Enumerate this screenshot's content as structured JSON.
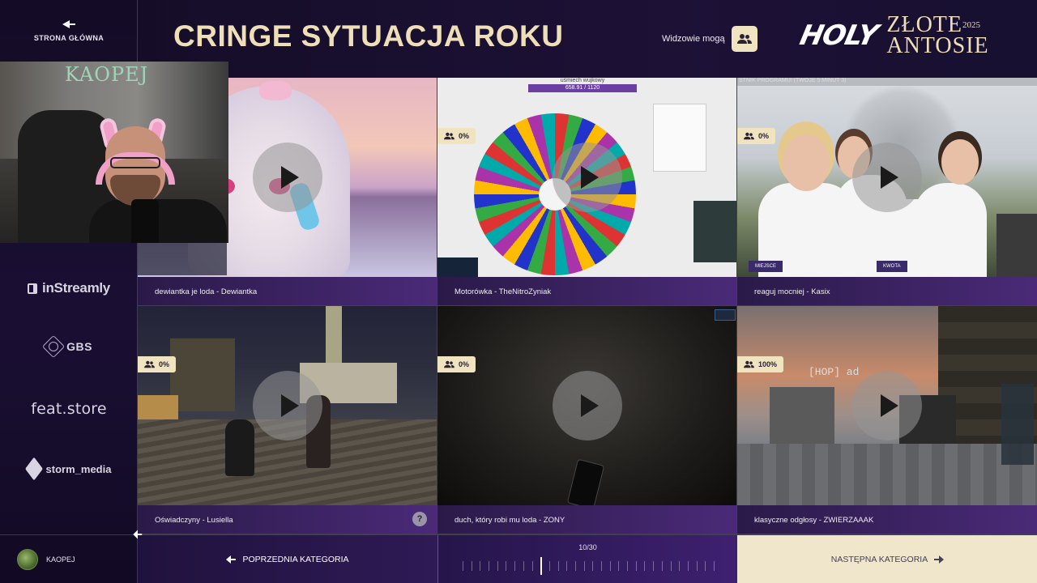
{
  "sidebar": {
    "home_label": "STRONA GŁÓWNA",
    "sponsors": [
      "inStreamly",
      "GBS",
      "feat.store",
      "storm_media"
    ],
    "user_name": "KAOPEJ"
  },
  "header": {
    "title": "CRINGE SYTUACJA ROKU",
    "viewers_label": "Widzowie mogą",
    "logo_holy": "HOLY",
    "logo_line1": "ZŁOTE",
    "logo_year": "2025",
    "logo_line2": "ANTOSIE"
  },
  "webcam": {
    "wall_text": "KAOPEJ"
  },
  "clips": [
    {
      "caption": "dewiantka je loda - Dewiantka",
      "percent": "",
      "has_help": false
    },
    {
      "caption": "Motorówka - TheNitroZyniak",
      "percent": "0%",
      "has_help": false,
      "overlay_title": "uśmiech wujkowy",
      "overlay_value": "658.91 / 1120"
    },
    {
      "caption": "reaguj mocniej - Kasix",
      "percent": "0%",
      "has_help": false,
      "overlay_top": "STNIK PROGRAMU! (TWOJE 5 MINUT 3)",
      "tag_left": "MIEJSCE",
      "tag_right": "KWOTA"
    },
    {
      "caption": "Oświadczyny - Lusiella",
      "percent": "0%",
      "has_help": true
    },
    {
      "caption": "duch, który robi mu loda - ZONY",
      "percent": "0%",
      "has_help": false
    },
    {
      "caption": "klasyczne odgłosy - ZWIERZAAAK",
      "percent": "100%",
      "has_help": false,
      "overlay_name": "[HOP] ad"
    }
  ],
  "help_glyph": "?",
  "footer": {
    "prev_label": "POPRZEDNIA KATEGORIA",
    "next_label": "NASTĘPNA KATEGORIA",
    "progress_text": "10/30",
    "progress_current": 10,
    "progress_total": 30
  },
  "colors": {
    "accent_gold": "#eedfb9",
    "badge_bg": "#efe3c0",
    "caption_bg": "#4a2a78"
  },
  "icons": [
    "back-arrow-icon",
    "users-icon",
    "play-icon",
    "help-icon",
    "prev-arrow-icon",
    "next-arrow-icon"
  ]
}
